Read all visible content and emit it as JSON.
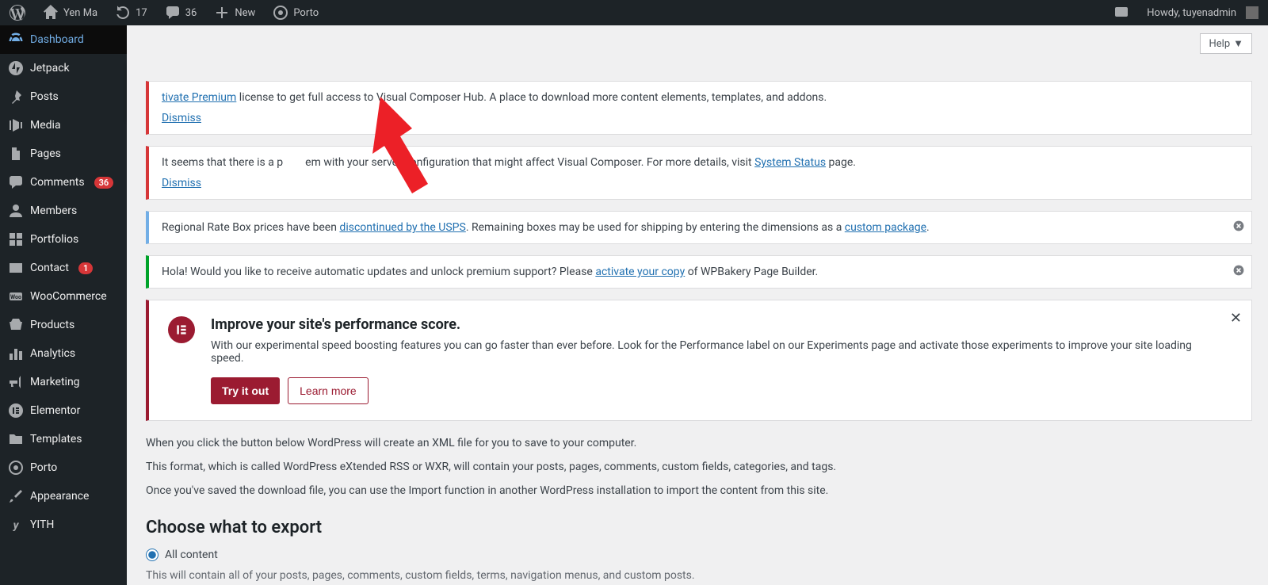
{
  "adminbar": {
    "site_name": "Yen Ma",
    "updates_count": "17",
    "comments_count": "36",
    "new_label": "New",
    "porto_label": "Porto",
    "greeting": "Howdy, tuyenadmin"
  },
  "sidebar": {
    "items": [
      {
        "label": "Dashboard",
        "current": true
      },
      {
        "label": "Jetpack"
      },
      {
        "label": "Posts"
      },
      {
        "label": "Media"
      },
      {
        "label": "Pages"
      },
      {
        "label": "Comments",
        "badge": "36"
      },
      {
        "label": "Members"
      },
      {
        "label": "Portfolios"
      },
      {
        "label": "Contact",
        "badge": "1"
      },
      {
        "label": "WooCommerce"
      },
      {
        "label": "Products"
      },
      {
        "label": "Analytics"
      },
      {
        "label": "Marketing"
      },
      {
        "label": "Elementor"
      },
      {
        "label": "Templates"
      },
      {
        "label": "Porto"
      },
      {
        "label": "Appearance"
      },
      {
        "label": "YITH"
      }
    ]
  },
  "flyout": {
    "home": "Home",
    "updates": "Updates",
    "updates_badge": "17"
  },
  "help": {
    "label": "Help"
  },
  "notices": {
    "vc": {
      "link1": "tivate Premium",
      "text1": " license to get full access to Visual Composer Hub. A place to download more content elements, templates, and addons.",
      "dismiss": "Dismiss"
    },
    "server": {
      "text_a": "It seems that there is a p",
      "text_b": "em with your server configuration that might affect Visual Composer. For more details, visit ",
      "link1": "System Status",
      "text_c": " page.",
      "dismiss": "Dismiss"
    },
    "usps": {
      "text_a": "Regional Rate Box prices have been ",
      "link1": "discontinued by the USPS",
      "text_b": ". Remaining boxes may be used for shipping by entering the dimensions as a ",
      "link2": "custom package",
      "text_c": "."
    },
    "wpbakery": {
      "text_a": "Hola! Would you like to receive automatic updates and unlock premium support? Please ",
      "link1": "activate your copy",
      "text_b": " of WPBakery Page Builder."
    },
    "elementor": {
      "title": "Improve your site's performance score.",
      "desc": "With our experimental speed boosting features you can go faster than ever before. Look for the Performance label on our Experiments page and activate those experiments to improve your site loading speed.",
      "try": "Try it out",
      "learn": "Learn more"
    }
  },
  "export": {
    "p1": "When you click the button below WordPress will create an XML file for you to save to your computer.",
    "p2": "This format, which is called WordPress eXtended RSS or WXR, will contain your posts, pages, comments, custom fields, categories, and tags.",
    "p3": "Once you've saved the download file, you can use the Import function in another WordPress installation to import the content from this site.",
    "heading": "Choose what to export",
    "all_content": "All content",
    "hint": "This will contain all of your posts, pages, comments, custom fields, terms, navigation menus, and custom posts."
  }
}
